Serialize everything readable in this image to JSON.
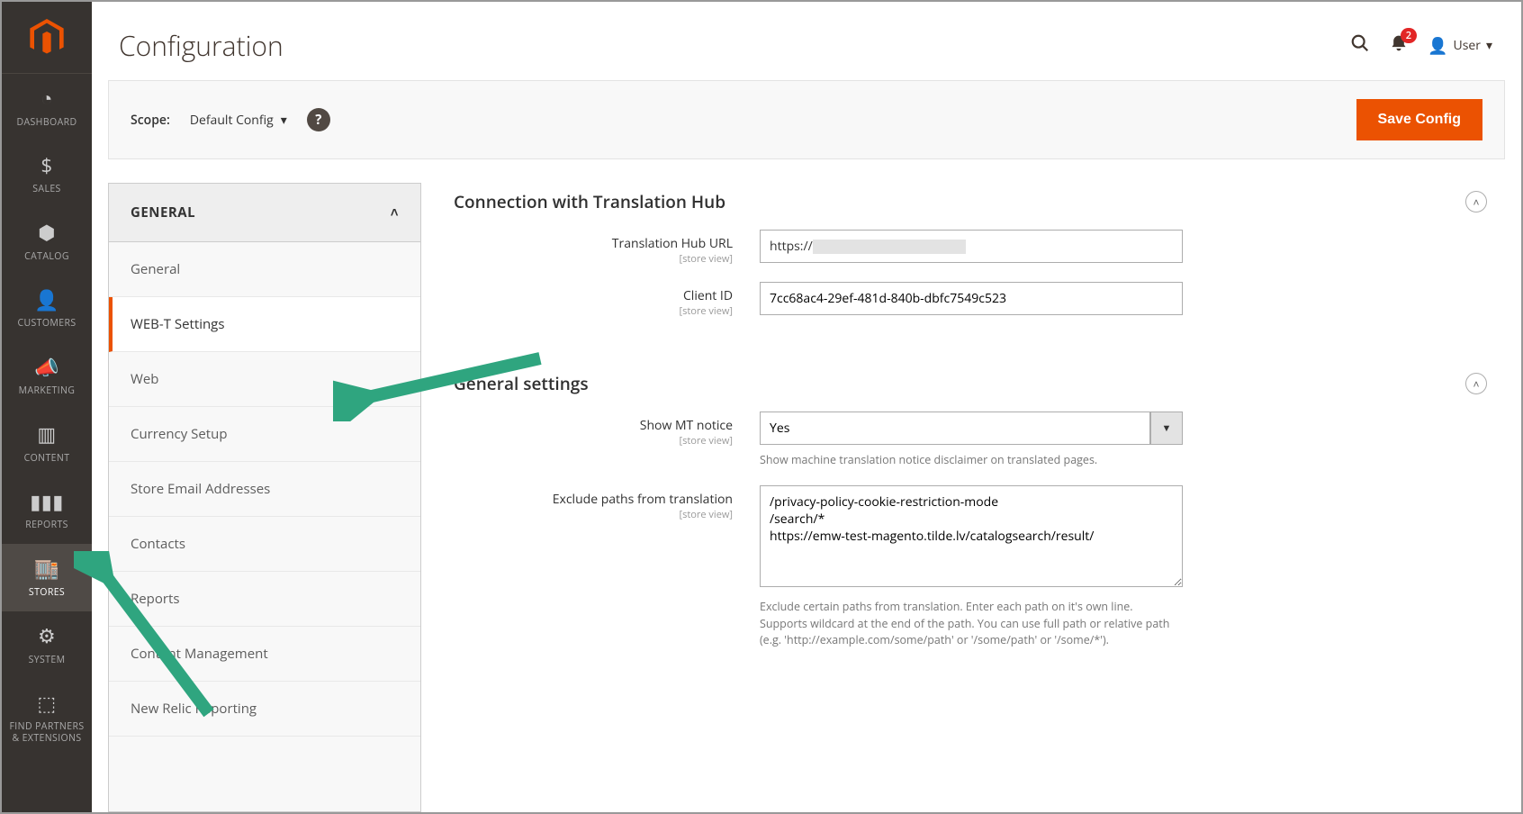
{
  "sidebar": {
    "items": [
      {
        "icon": "gauge",
        "label": "DASHBOARD"
      },
      {
        "icon": "dollar",
        "label": "SALES"
      },
      {
        "icon": "cube",
        "label": "CATALOG"
      },
      {
        "icon": "person",
        "label": "CUSTOMERS"
      },
      {
        "icon": "bullhorn",
        "label": "MARKETING"
      },
      {
        "icon": "layout",
        "label": "CONTENT"
      },
      {
        "icon": "bars",
        "label": "REPORTS"
      },
      {
        "icon": "store",
        "label": "STORES",
        "active": true
      },
      {
        "icon": "gear",
        "label": "SYSTEM"
      },
      {
        "icon": "boxes",
        "label": "FIND PARTNERS & EXTENSIONS"
      }
    ]
  },
  "header": {
    "title": "Configuration",
    "notification_count": "2",
    "username": "User"
  },
  "scope": {
    "label": "Scope:",
    "value": "Default Config",
    "save_label": "Save Config"
  },
  "config_nav": {
    "group": "GENERAL",
    "items": [
      {
        "label": "General"
      },
      {
        "label": "WEB-T Settings",
        "active": true
      },
      {
        "label": "Web"
      },
      {
        "label": "Currency Setup"
      },
      {
        "label": "Store Email Addresses"
      },
      {
        "label": "Contacts"
      },
      {
        "label": "Reports"
      },
      {
        "label": "Content Management"
      },
      {
        "label": "New Relic Reporting"
      }
    ]
  },
  "sections": {
    "connection": {
      "title": "Connection with Translation Hub",
      "url_label": "Translation Hub URL",
      "url_scope": "[store view]",
      "url_value": "https://",
      "client_label": "Client ID",
      "client_scope": "[store view]",
      "client_value": "7cc68ac4-29ef-481d-840b-dbfc7549c523"
    },
    "general": {
      "title": "General settings",
      "notice_label": "Show MT notice",
      "notice_scope": "[store view]",
      "notice_value": "Yes",
      "notice_note": "Show machine translation notice disclaimer on translated pages.",
      "exclude_label": "Exclude paths from translation",
      "exclude_scope": "[store view]",
      "exclude_value": "/privacy-policy-cookie-restriction-mode\n/search/*\nhttps://emw-test-magento.tilde.lv/catalogsearch/result/",
      "exclude_note": "Exclude certain paths from translation. Enter each path on it's own line. Supports wildcard at the end of the path. You can use full path or relative path (e.g. 'http://example.com/some/path' or '/some/path' or '/some/*')."
    }
  }
}
